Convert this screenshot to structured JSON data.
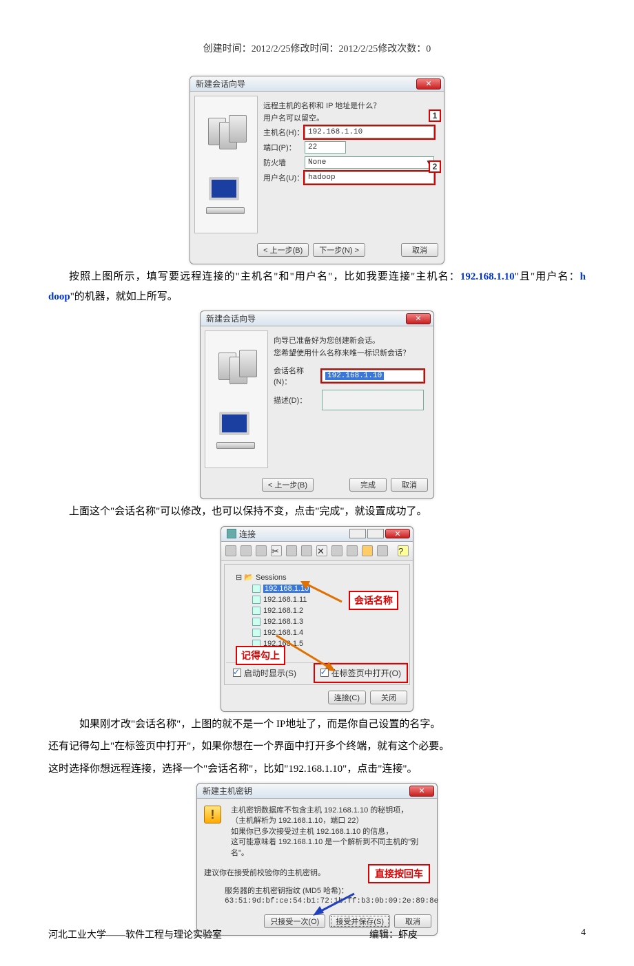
{
  "header": "创建时间：2012/2/25修改时间：2012/2/25修改次数：0",
  "wizard1": {
    "title": "新建会话向导",
    "q1": "远程主机的名称和 IP 地址是什么？",
    "q2": "用户名可以留空。",
    "host_label": "主机名(H)：",
    "host_value": "192.168.1.10",
    "port_label": "端口(P)：",
    "port_value": "22",
    "fw_label": "防火墙",
    "fw_value": "None",
    "user_label": "用户名(U)：",
    "user_value": "hadoop",
    "c1": "1",
    "c2": "2",
    "btn_prev": "< 上一步(B)",
    "btn_next": "下一步(N) >",
    "btn_cancel": "取消"
  },
  "para1a": "按照上图所示，填写要远程连接的\"主机名\"和\"用户名\"，比如我要连接\"主机名：",
  "para1b": "192.168.1.10",
  "para1c": "\"且\"用户名：",
  "para1d": "h doop",
  "para1e": "\"的机器，就如上所写。",
  "wizard2": {
    "title": "新建会话向导",
    "l1": "向导已准备好为您创建新会话。",
    "l2": "您希望使用什么名称来唯一标识新会话？",
    "name_label": "会话名称(N)：",
    "name_value": "192.168.1.10",
    "desc_label": "描述(D)：",
    "btn_prev": "< 上一步(B)",
    "btn_done": "完成",
    "btn_cancel": "取消"
  },
  "para2": "上面这个\"会话名称\"可以修改，也可以保持不变，点击\"完成\"，就设置成功了。",
  "conn": {
    "title": "连接",
    "folder": "Sessions",
    "items": [
      "192.168.1.10",
      "192.168.1.11",
      "192.168.1.2",
      "192.168.1.3",
      "192.168.1.4",
      "192.168.1.5"
    ],
    "note1": "会话名称",
    "note2": "记得勾上",
    "chk_start": "启动时显示(S)",
    "chk_tab": "在标签页中打开(O)",
    "btn_connect": "连接(C)",
    "btn_close": "关闭"
  },
  "para3a": "如果刚才改\"会话名称\"，上图的就不是一个 IP地址了，而是你自己设置的名字。",
  "para3b": "还有记得勾上\"在标签页中打开\"，如果你想在一个界面中打开多个终端，就有这个必要。",
  "para3c": "这时选择你想远程连接，选择一个\"会话名称\"，比如\"192.168.1.10\"，点击\"连接\"。",
  "hostkey": {
    "title": "新建主机密钥",
    "l1": "主机密钥数据库不包含主机 192.168.1.10 的秘钥项，",
    "l2": "（主机解析为 192.168.1.10，端口 22）",
    "l3": "如果你已多次接受过主机 192.168.1.10 的信息，",
    "l4": "这可能意味着 192.168.1.10 是一个解析到不同主机的\"别名\"。",
    "l5": "建议你在接受前校验你的主机密钥。",
    "note": "直接按回车",
    "l6": "服务器的主机密钥指纹 (MD5 哈希)：",
    "l7": "63:51:9d:bf:ce:54:b1:72:1b:ff:b3:0b:09:2e:89:8e",
    "btn_once": "只接受一次(O)",
    "btn_save": "接受并保存(S)",
    "btn_cancel": "取消"
  },
  "footer": {
    "left": "河北工业大学——软件工程与理论实验室",
    "editor": "编辑：虾皮",
    "page": "4"
  }
}
